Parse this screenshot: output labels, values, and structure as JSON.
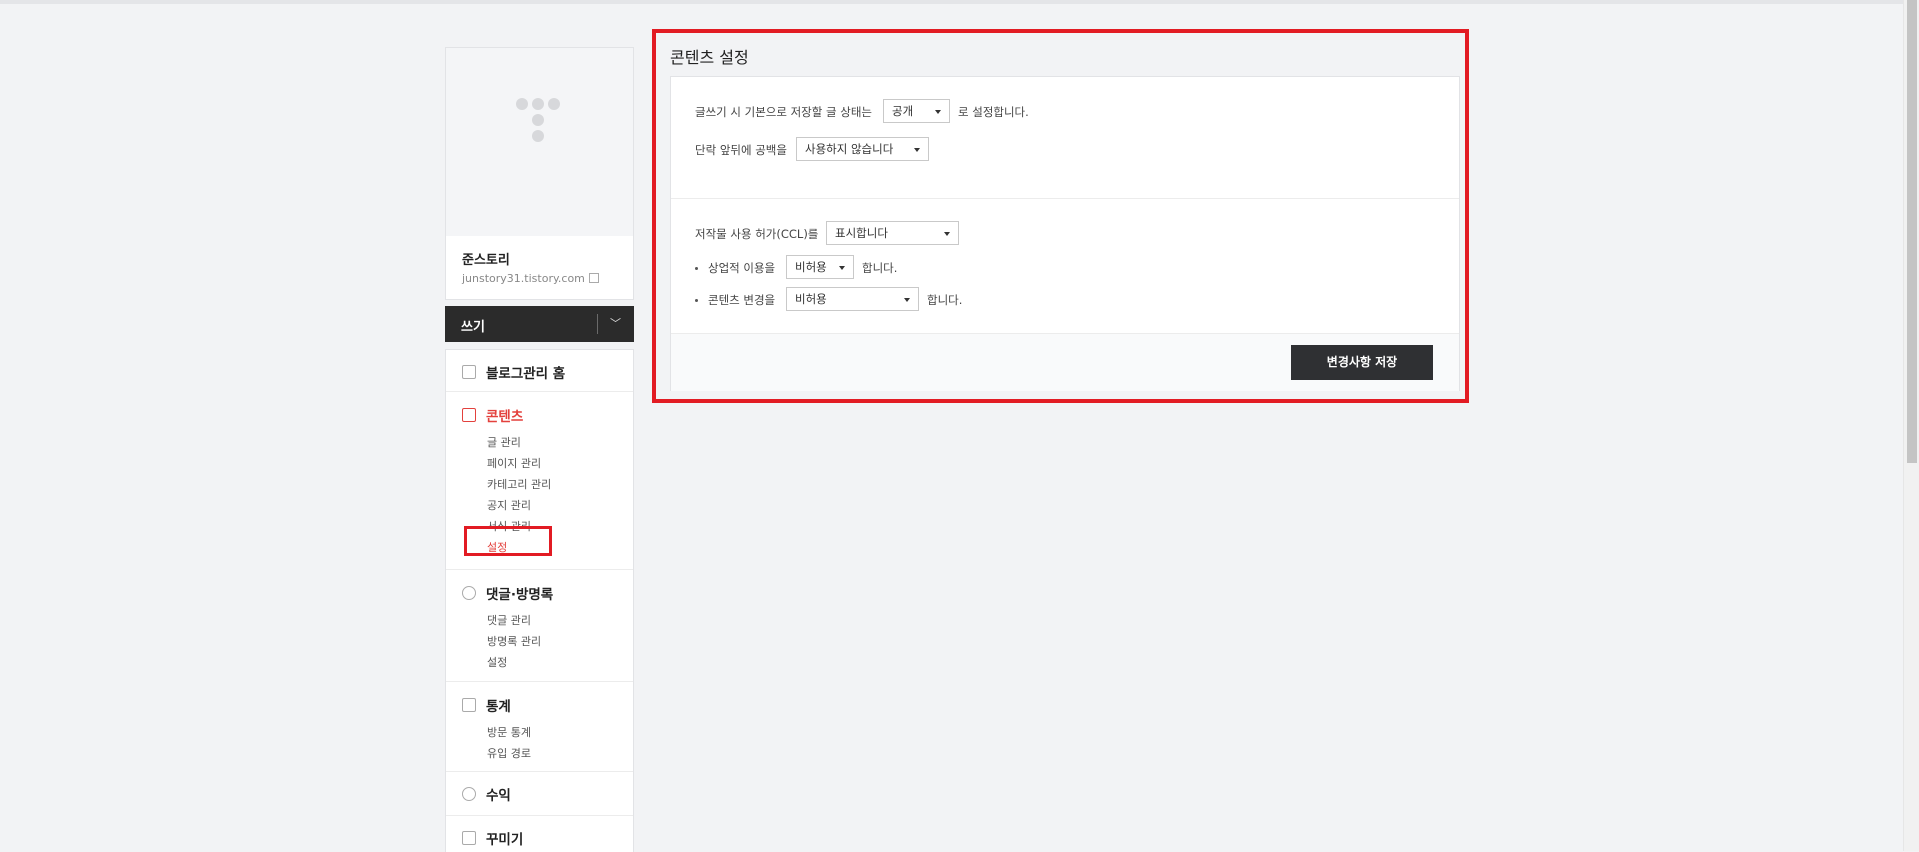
{
  "sidebar": {
    "blog_name": "준스토리",
    "blog_url": "junstory31.tistory.com",
    "write_label": "쓰기",
    "menu": {
      "home": "블로그관리 홈",
      "contents": {
        "label": "콘텐츠",
        "items": [
          "글 관리",
          "페이지 관리",
          "카테고리 관리",
          "공지 관리",
          "서식 관리",
          "설정"
        ]
      },
      "comments": {
        "label": "댓글·방명록",
        "items": [
          "댓글 관리",
          "방명록 관리",
          "설정"
        ]
      },
      "stats": {
        "label": "통계",
        "items": [
          "방문 통계",
          "유입 경로"
        ]
      },
      "revenue": "수익",
      "design": "꾸미기"
    }
  },
  "main": {
    "title": "콘텐츠 설정",
    "default_status": {
      "prefix": "글쓰기 시 기본으로 저장할 글 상태는",
      "value": "공개",
      "suffix": "로 설정합니다."
    },
    "paragraph_spacing": {
      "label": "단락 앞뒤에 공백을",
      "value": "사용하지 않습니다"
    },
    "ccl": {
      "label": "저작물 사용 허가(CCL)를",
      "value": "표시합니다",
      "commercial": {
        "label": "상업적 이용을",
        "value": "비허용",
        "suffix": "합니다."
      },
      "modification": {
        "label": "콘텐츠 변경을",
        "value": "비허용",
        "suffix": "합니다."
      }
    },
    "save_label": "변경사항 저장"
  },
  "colors": {
    "accent": "#e3413d",
    "highlight": "#e21b23",
    "dark": "#2b2b2b"
  },
  "icons": [
    "tistory-logo-icon",
    "external-link-icon",
    "chevron-down-icon",
    "home-icon",
    "document-icon",
    "comment-icon",
    "chart-icon",
    "coin-icon",
    "layout-icon"
  ]
}
